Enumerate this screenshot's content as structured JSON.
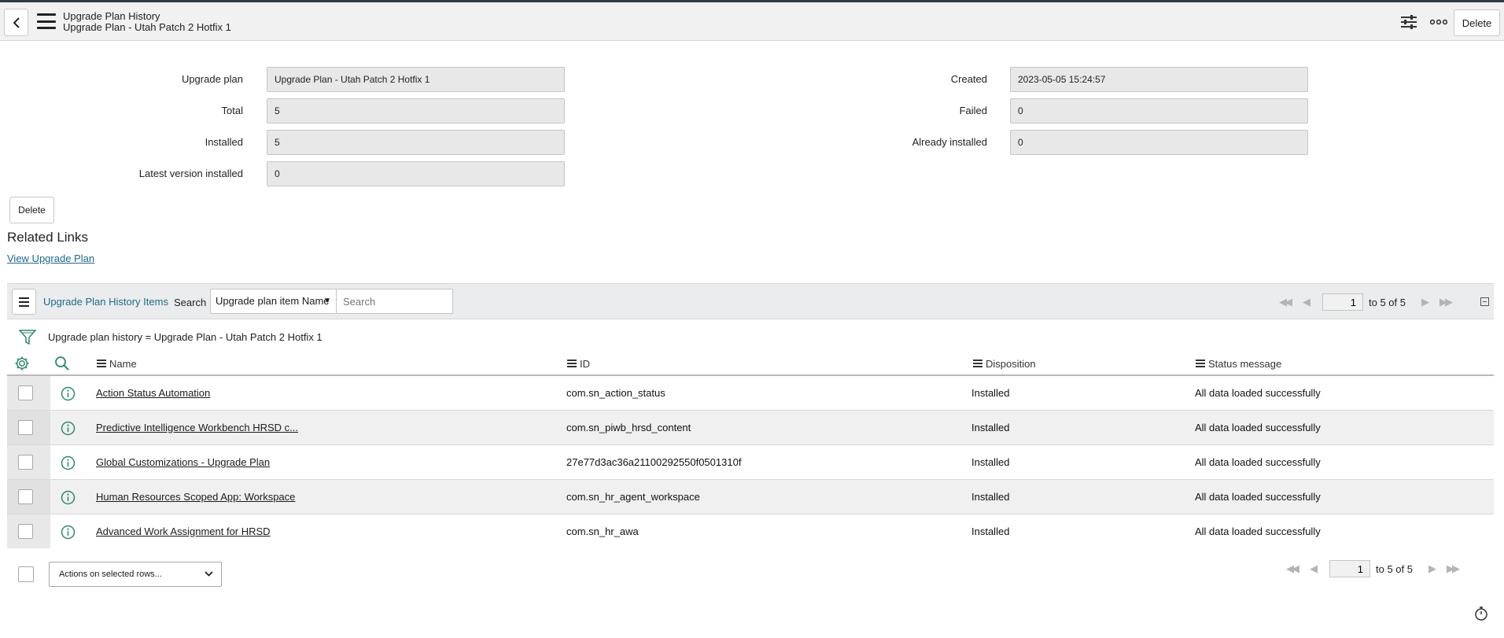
{
  "header": {
    "title_line1": "Upgrade Plan History",
    "title_line2": "Upgrade Plan - Utah Patch 2 Hotfix 1",
    "delete_label": "Delete",
    "icons": [
      "chevron-left-icon",
      "hamburger-icon",
      "settings-sliders-icon",
      "more-options-icon"
    ]
  },
  "form": {
    "upgrade_plan": {
      "label": "Upgrade plan",
      "value": "Upgrade Plan - Utah Patch 2 Hotfix 1"
    },
    "total": {
      "label": "Total",
      "value": "5"
    },
    "installed": {
      "label": "Installed",
      "value": "5"
    },
    "latest_version_installed": {
      "label": "Latest version installed",
      "value": "0"
    },
    "created": {
      "label": "Created",
      "value": "2023-05-05 15:24:57"
    },
    "failed": {
      "label": "Failed",
      "value": "0"
    },
    "already_installed": {
      "label": "Already installed",
      "value": "0"
    },
    "delete_label": "Delete"
  },
  "related": {
    "title": "Related Links",
    "link": "View Upgrade Plan"
  },
  "list": {
    "title": "Upgrade Plan History Items",
    "search_label": "Search",
    "search_field": "Upgrade plan item Name",
    "search_placeholder": "Search",
    "page": "1",
    "range_text": "to 5 of 5",
    "filter_text": "Upgrade plan history = Upgrade Plan - Utah Patch 2 Hotfix 1",
    "columns": [
      "Name",
      "ID",
      "Disposition",
      "Status message"
    ],
    "rows": [
      {
        "name": "Action Status Automation",
        "id": "com.sn_action_status",
        "disposition": "Installed",
        "status": "All data loaded successfully"
      },
      {
        "name": "Predictive Intelligence Workbench HRSD c...",
        "id": "com.sn_piwb_hrsd_content",
        "disposition": "Installed",
        "status": "All data loaded successfully"
      },
      {
        "name": "Global Customizations - Upgrade Plan",
        "id": "27e77d3ac36a21100292550f0501310f",
        "disposition": "Installed",
        "status": "All data loaded successfully"
      },
      {
        "name": "Human Resources Scoped App: Workspace",
        "id": "com.sn_hr_agent_workspace",
        "disposition": "Installed",
        "status": "All data loaded successfully"
      },
      {
        "name": "Advanced Work Assignment for HRSD",
        "id": "com.sn_hr_awa",
        "disposition": "Installed",
        "status": "All data loaded successfully"
      }
    ],
    "actions_label": "Actions on selected rows..."
  },
  "colors": {
    "link": "#1d6a8a",
    "icon_green": "#2e8a6a",
    "topbar_border": "#303a46"
  }
}
